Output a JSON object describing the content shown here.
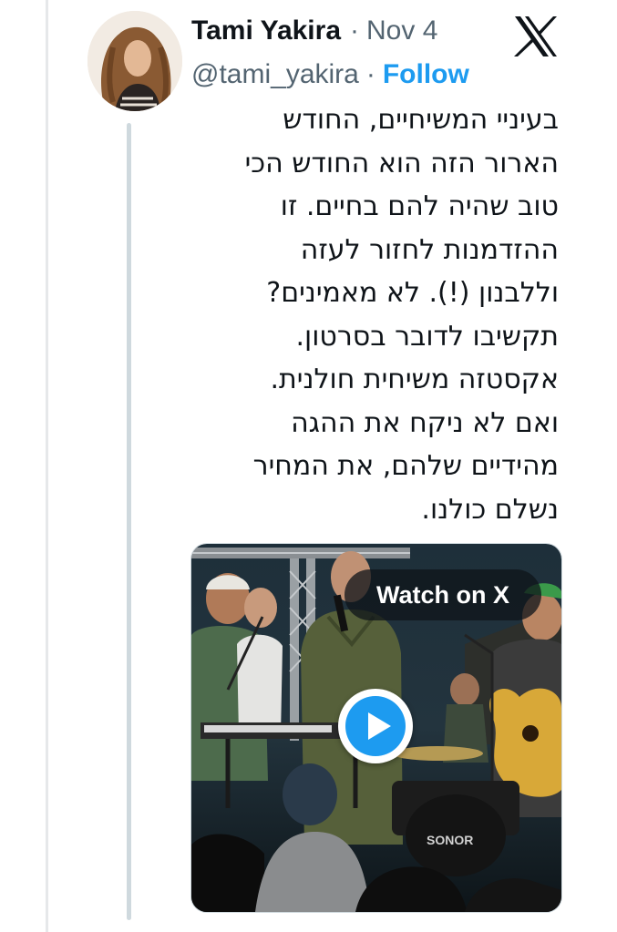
{
  "tweet": {
    "author_name": "Tami Yakira",
    "date": "Nov 4",
    "handle": "@tami_yakira",
    "separator": "·",
    "follow_label": "Follow",
    "text_lines": [
      "בעיניי המשיחיים, החודש",
      "הארור הזה הוא החודש הכי",
      "טוב שהיה להם בחיים. זו",
      "ההזדמנות לחזור לעזה",
      "וללבנון (!). לא מאמינים?",
      "תקשיבו לדובר בסרטון.",
      "אקסטזה משיחית חולנית.",
      "ואם לא ניקח את ההגה",
      "מהידיים שלהם, את המחיר",
      "נשלם כולנו."
    ]
  },
  "media": {
    "watch_label": "Watch on X",
    "drum_brand": "SONOR"
  },
  "icons": {
    "logo": "x-logo-icon",
    "play": "play-icon",
    "avatar": "avatar"
  },
  "colors": {
    "follow_blue": "#1d9bf0",
    "meta_gray": "#536471",
    "thread_line": "#cfd9de",
    "play_blue": "#1d9bf0"
  }
}
